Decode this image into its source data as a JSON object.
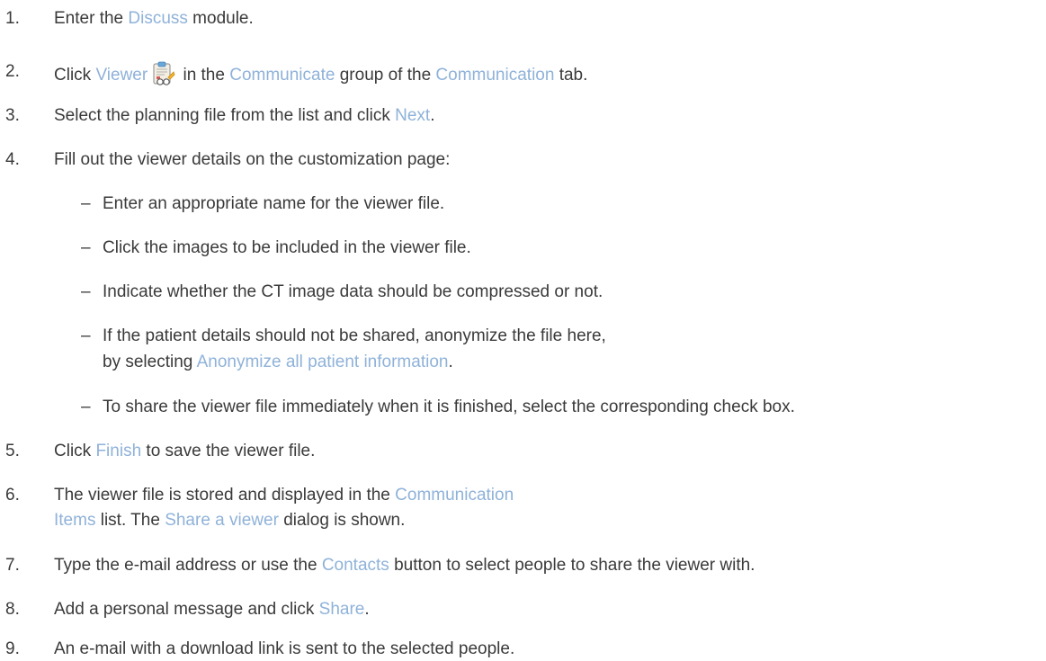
{
  "steps": [
    {
      "num": "1.",
      "parts": [
        "Enter the ",
        "Discuss",
        " module."
      ]
    },
    {
      "num": "2.",
      "parts": [
        "Click ",
        "Viewer",
        " in the ",
        "Communicate",
        " group of the ",
        "Communication",
        " tab."
      ],
      "icon": "viewer-clipboard-icon"
    },
    {
      "num": "3.",
      "parts": [
        "Select the planning file from the list and click ",
        "Next",
        "."
      ]
    },
    {
      "num": "4.",
      "parts": [
        "Fill out the viewer details on the customization page:"
      ]
    },
    {
      "num": "5.",
      "parts": [
        "Click ",
        "Finish",
        " to save the viewer file."
      ]
    },
    {
      "num": "6.",
      "line1": [
        "The viewer file is stored and displayed in the ",
        "Communication"
      ],
      "line2": [
        "Items",
        " list. The ",
        "Share a viewer",
        " dialog is shown."
      ]
    },
    {
      "num": "7.",
      "parts": [
        "Type the e-mail address or use the ",
        "Contacts",
        " button to select people to share the viewer with."
      ]
    },
    {
      "num": "8.",
      "parts": [
        "Add a personal message and click ",
        "Share",
        "."
      ]
    },
    {
      "num": "9.",
      "parts": [
        "An e-mail with a download link is sent to the selected people."
      ]
    }
  ],
  "substeps": [
    {
      "dash": "–",
      "text": "Enter an appropriate name for the viewer file."
    },
    {
      "dash": "–",
      "text": "Click the images to be included in the viewer file."
    },
    {
      "dash": "–",
      "text": "Indicate whether the CT image data should be compressed or not."
    },
    {
      "dash": "–",
      "line1": "If the patient details should not be shared, anonymize the file here,",
      "line2": [
        "by selecting ",
        "Anonymize all patient information",
        "."
      ]
    },
    {
      "dash": "–",
      "text": "To share the viewer file immediately when it is finished, select the corresponding check box."
    }
  ],
  "colors": {
    "text": "#3a3a3a",
    "highlight": "#8fb2d9"
  }
}
